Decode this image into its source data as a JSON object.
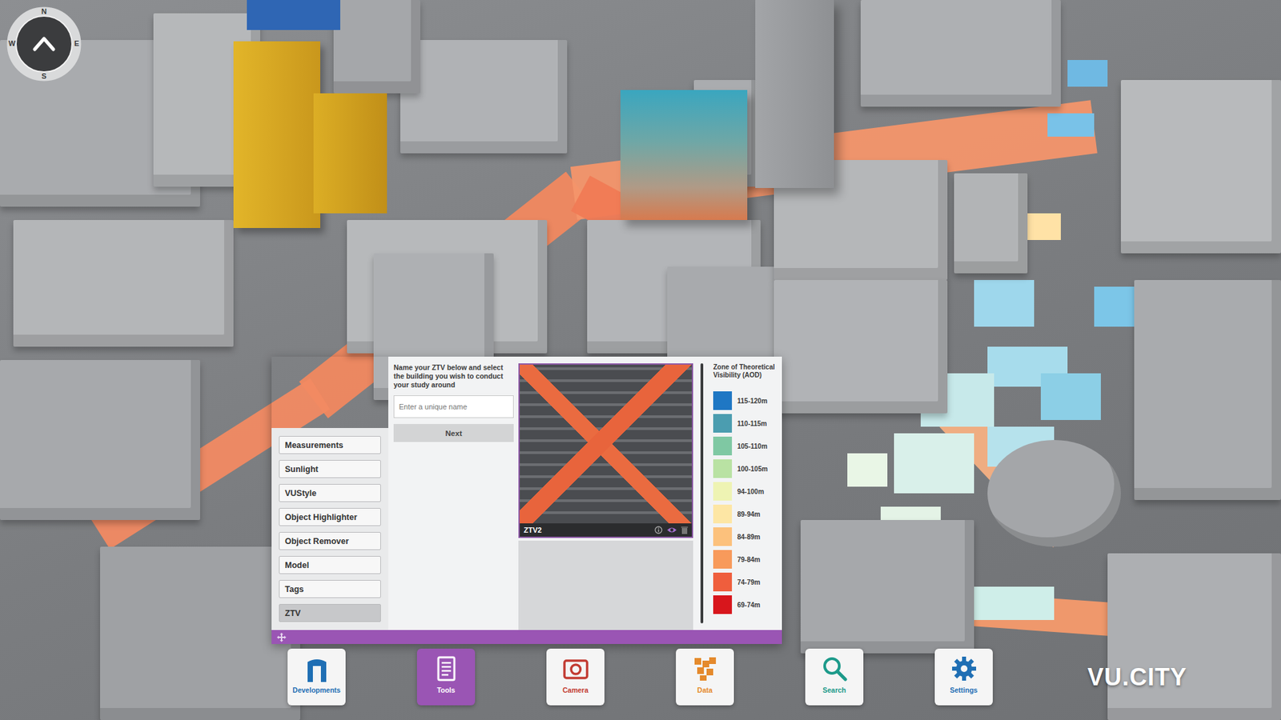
{
  "compass": {
    "letters": [
      {
        "label": "N"
      },
      {
        "label": "E"
      },
      {
        "label": "S"
      },
      {
        "label": "W"
      }
    ]
  },
  "tool_panel": {
    "menu": [
      {
        "label": "Measurements",
        "selected": false
      },
      {
        "label": "Sunlight",
        "selected": false
      },
      {
        "label": "VUStyle",
        "selected": false
      },
      {
        "label": "Object Highlighter",
        "selected": false
      },
      {
        "label": "Object Remover",
        "selected": false
      },
      {
        "label": "Model",
        "selected": false
      },
      {
        "label": "Tags",
        "selected": false
      },
      {
        "label": "ZTV",
        "selected": true
      }
    ],
    "instructions": "Name your ZTV below and select the building you wish to conduct your study around",
    "name_field": {
      "placeholder": "Enter a unique name"
    },
    "next_button": "Next",
    "studies": [
      {
        "name": "ZTV2",
        "visible": true
      }
    ],
    "legend": {
      "title": "Zone of Theoretical Visibility (AOD)",
      "entries": [
        {
          "label": "115-120m",
          "color": "#1f77c4"
        },
        {
          "label": "110-115m",
          "color": "#4b9db0"
        },
        {
          "label": "105-110m",
          "color": "#7fc8a3"
        },
        {
          "label": "100-105m",
          "color": "#b9e2a3"
        },
        {
          "label": "94-100m",
          "color": "#eef3b3"
        },
        {
          "label": "89-94m",
          "color": "#fde6a4"
        },
        {
          "label": "84-89m",
          "color": "#fcc17c"
        },
        {
          "label": "79-84m",
          "color": "#f89a5b"
        },
        {
          "label": "74-79m",
          "color": "#ef5e3d"
        },
        {
          "label": "69-74m",
          "color": "#d8161c"
        }
      ]
    }
  },
  "toolbar": [
    {
      "label": "Developments",
      "selected": false
    },
    {
      "label": "Tools",
      "selected": true
    },
    {
      "label": "Camera",
      "selected": false
    },
    {
      "label": "Data",
      "selected": false
    },
    {
      "label": "Search",
      "selected": false
    },
    {
      "label": "Settings",
      "selected": false
    }
  ],
  "logo": "VU.CITY"
}
